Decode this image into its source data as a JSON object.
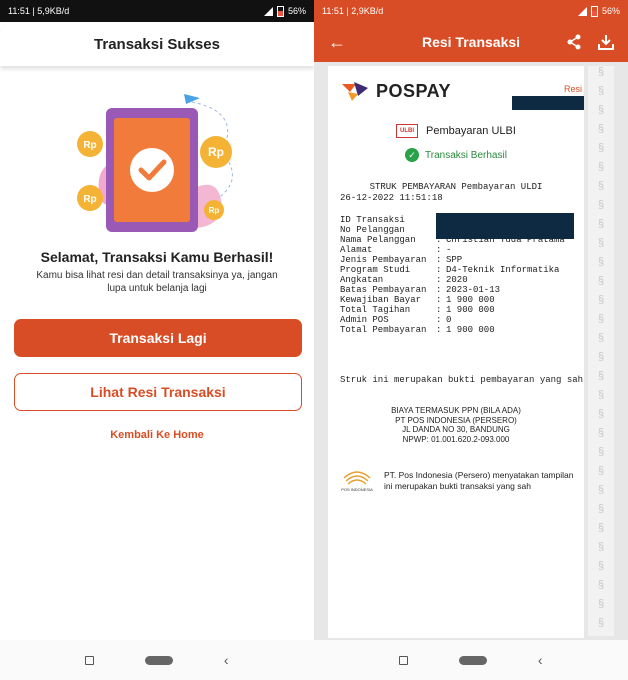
{
  "left": {
    "status_time": "11:51 | 5,9KB/d",
    "status_battery": "56%",
    "header_title": "Transaksi Sukses",
    "success_title": "Selamat, Transaksi Kamu Berhasil!",
    "success_subtitle": "Kamu bisa lihat resi dan detail transaksinya ya, jangan lupa untuk belanja lagi",
    "coin_label": "Rp",
    "btn_again": "Transaksi Lagi",
    "btn_receipt": "Lihat Resi Transaksi",
    "link_home": "Kembali Ke Home"
  },
  "right": {
    "status_time": "11:51 | 2,9KB/d",
    "status_battery": "56%",
    "header_title": "Resi Transaksi",
    "brand": "POSPAY",
    "resi_label": "Resi",
    "payment_label": "Pembayaran ULBI",
    "ulbi_logo": "ULBI",
    "status_text": "Transaksi Berhasil",
    "struk_title": "STRUK PEMBAYARAN Pembayaran ULDI",
    "datetime": "26-12-2022 11:51:18",
    "fields": [
      {
        "label": "ID Transaksi",
        "value": ""
      },
      {
        "label": "No Pelanggan",
        "value": ""
      },
      {
        "label": "Nama Pelanggan",
        "value": "Christian Yuda Pratama"
      },
      {
        "label": "Alamat",
        "value": "-"
      },
      {
        "label": "Jenis Pembayaran",
        "value": "SPP"
      },
      {
        "label": "Program Studi",
        "value": "D4-Teknik Informatika"
      },
      {
        "label": "Angkatan",
        "value": "2020"
      },
      {
        "label": "Batas Pembayaran",
        "value": "2023-01-13"
      },
      {
        "label": "Kewajiban Bayar",
        "value": "1 900 000"
      },
      {
        "label": "Total Tagihan",
        "value": "1 900 000"
      },
      {
        "label": "Admin POS",
        "value": "0"
      },
      {
        "label": "Total Pembayaran",
        "value": "1 900 000"
      }
    ],
    "note": "Struk ini merupakan bukti pembayaran yang sah",
    "footer_lines": [
      "BIAYA TERMASUK PPN (BILA ADA)",
      "PT POS INDONESIA (PERSERO)",
      "JL DANDA NO 30, BANDUNG",
      "NPWP: 01.001.620.2-093.000"
    ],
    "pos_logo_text": "POS INDONESIA",
    "pos_statement": "PT. Pos Indonesia (Persero) menyatakan tampilan ini merupakan bukti transaksi yang sah"
  },
  "colors": {
    "accent": "#d84d25",
    "success": "#2aa24a",
    "redaction": "#0e2a43",
    "coin": "#f5b335",
    "phone_purple": "#9b59b6"
  }
}
